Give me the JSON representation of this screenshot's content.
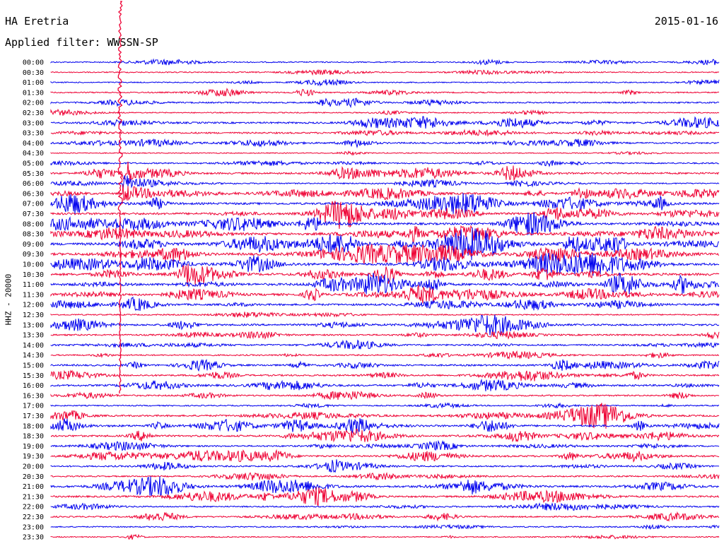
{
  "header": {
    "station": "HA Eretria",
    "date": "2015-01-16",
    "filter_label": "Applied filter: WWSSN-SP"
  },
  "chart_data": {
    "type": "line",
    "title": "HA Eretria",
    "date": "2015-01-16",
    "filter": "WWSSN-SP",
    "ylabel": "HHZ - 20000",
    "time_labels": [
      "00:00",
      "00:30",
      "01:00",
      "01:30",
      "02:00",
      "02:30",
      "03:00",
      "03:30",
      "04:00",
      "04:30",
      "05:00",
      "05:30",
      "06:00",
      "06:30",
      "07:00",
      "07:30",
      "08:00",
      "08:30",
      "09:00",
      "09:30",
      "10:00",
      "10:30",
      "11:00",
      "11:30",
      "12:00",
      "12:30",
      "13:00",
      "13:30",
      "14:00",
      "14:30",
      "15:00",
      "15:30",
      "16:00",
      "16:30",
      "17:00",
      "17:30",
      "18:00",
      "18:30",
      "19:00",
      "19:30",
      "20:00",
      "20:30",
      "21:00",
      "21:30",
      "22:00",
      "22:30",
      "23:00",
      "23:30"
    ],
    "trace_colors": [
      "#0000ee",
      "#ee0033"
    ],
    "activity_levels": [
      0.15,
      0.12,
      0.1,
      0.2,
      0.3,
      0.1,
      0.45,
      0.4,
      0.35,
      0.05,
      0.3,
      0.5,
      0.2,
      0.55,
      0.65,
      0.7,
      0.65,
      0.75,
      0.85,
      0.85,
      0.8,
      0.8,
      0.75,
      0.75,
      0.55,
      0.2,
      0.5,
      0.35,
      0.4,
      0.25,
      0.45,
      0.4,
      0.5,
      0.3,
      0.15,
      0.45,
      0.6,
      0.5,
      0.35,
      0.5,
      0.35,
      0.25,
      0.6,
      0.45,
      0.25,
      0.3,
      0.15,
      0.1
    ],
    "major_event_time": "05:30"
  }
}
